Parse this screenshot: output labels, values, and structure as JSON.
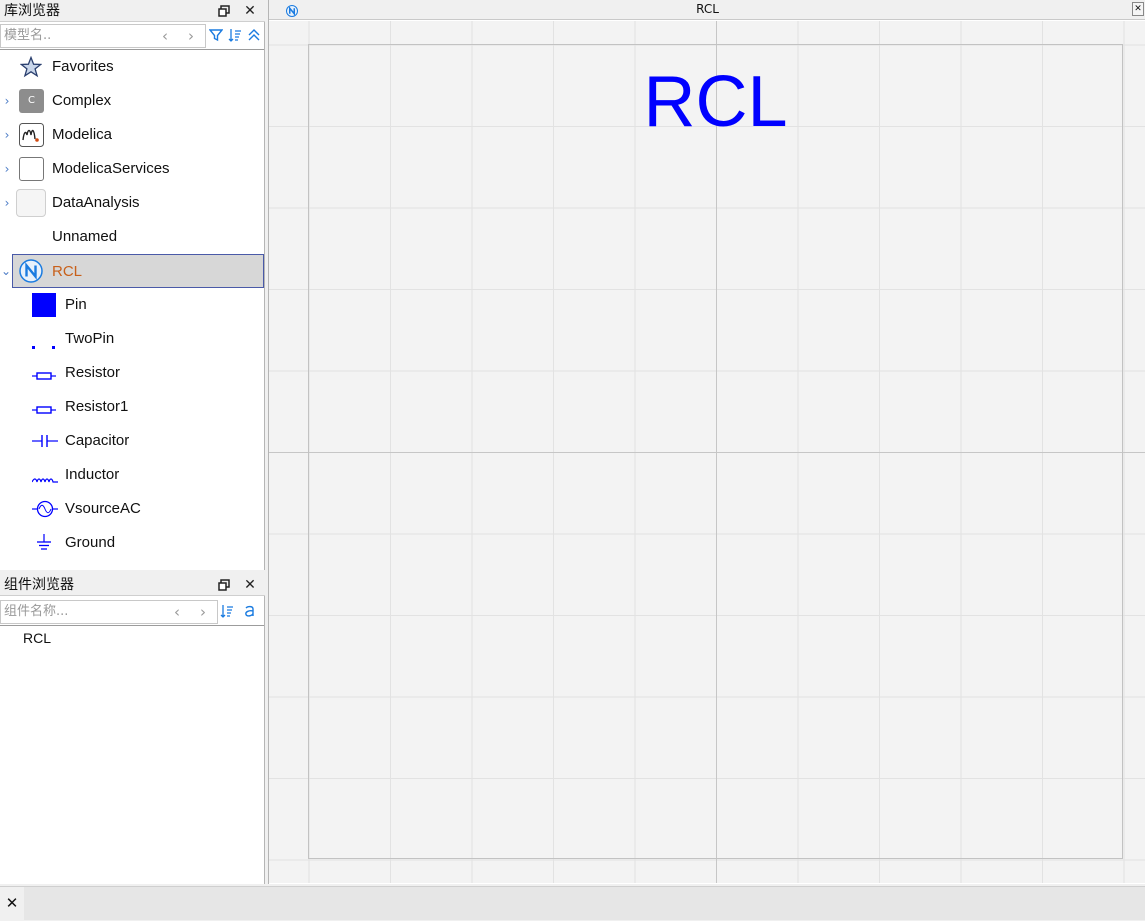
{
  "library_browser": {
    "title": "库浏览器",
    "search_placeholder": "模型名..",
    "items": [
      {
        "label": "Favorites",
        "icon": "star-icon",
        "expandable": false
      },
      {
        "label": "Complex",
        "icon": "complex-icon",
        "icon_text": "C",
        "expandable": true
      },
      {
        "label": "Modelica",
        "icon": "modelica-icon",
        "expandable": true
      },
      {
        "label": "ModelicaServices",
        "icon": "package-icon",
        "expandable": true
      },
      {
        "label": "DataAnalysis",
        "icon": "package-icon",
        "expandable": true
      },
      {
        "label": "Unnamed",
        "icon": "none",
        "expandable": false
      },
      {
        "label": "RCL",
        "icon": "n-package-icon",
        "expandable": true,
        "expanded": true,
        "selected": true,
        "color": "#c8601a"
      }
    ],
    "children": [
      {
        "label": "Pin",
        "icon": "pin-icon"
      },
      {
        "label": "TwoPin",
        "icon": "twopin-icon"
      },
      {
        "label": "Resistor",
        "icon": "resistor-icon"
      },
      {
        "label": "Resistor1",
        "icon": "resistor-icon"
      },
      {
        "label": "Capacitor",
        "icon": "capacitor-icon"
      },
      {
        "label": "Inductor",
        "icon": "inductor-icon"
      },
      {
        "label": "VsourceAC",
        "icon": "vsource-ac-icon"
      },
      {
        "label": "Ground",
        "icon": "ground-icon"
      }
    ]
  },
  "component_browser": {
    "title": "组件浏览器",
    "search_placeholder": "组件名称...",
    "items": [
      {
        "label": "RCL"
      }
    ]
  },
  "diagram": {
    "tab_title": "RCL",
    "canvas_text": "RCL",
    "canvas_text_color": "#0000ff",
    "grid": true
  },
  "colors": {
    "accent": "#1a7be0",
    "selection_border": "#4a5aa8",
    "component_blue": "#0000ff"
  }
}
